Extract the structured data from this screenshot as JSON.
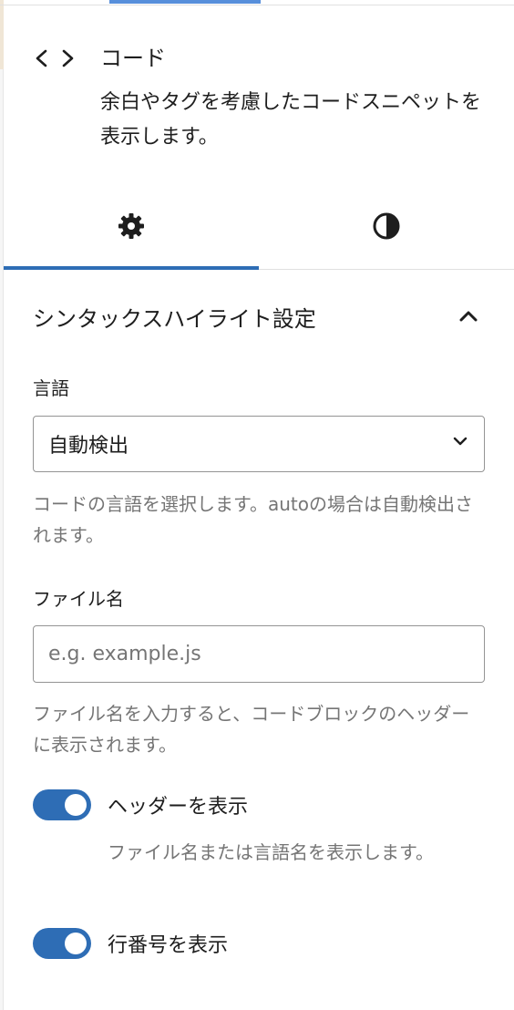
{
  "block": {
    "title": "コード",
    "description": "余白やタグを考慮したコードスニペットを表示します。",
    "icon": "code-brackets-icon"
  },
  "tabs": [
    {
      "name": "settings",
      "icon": "gear-icon",
      "active": true
    },
    {
      "name": "styles",
      "icon": "half-circle-contrast-icon",
      "active": false
    }
  ],
  "panel": {
    "title": "シンタックスハイライト設定",
    "expanded": true
  },
  "language": {
    "label": "言語",
    "selected": "自動検出",
    "help": "コードの言語を選択します。autoの場合は自動検出されます。"
  },
  "filename": {
    "label": "ファイル名",
    "placeholder": "e.g. example.js",
    "value": "",
    "help": "ファイル名を入力すると、コードブロックのヘッダーに表示されます。"
  },
  "show_header": {
    "label": "ヘッダーを表示",
    "help": "ファイル名または言語名を表示します。",
    "checked": true
  },
  "show_line_numbers": {
    "label": "行番号を表示",
    "checked": true
  },
  "colors": {
    "accent": "#2e6db5",
    "muted_text": "#757575",
    "border": "#949494"
  }
}
